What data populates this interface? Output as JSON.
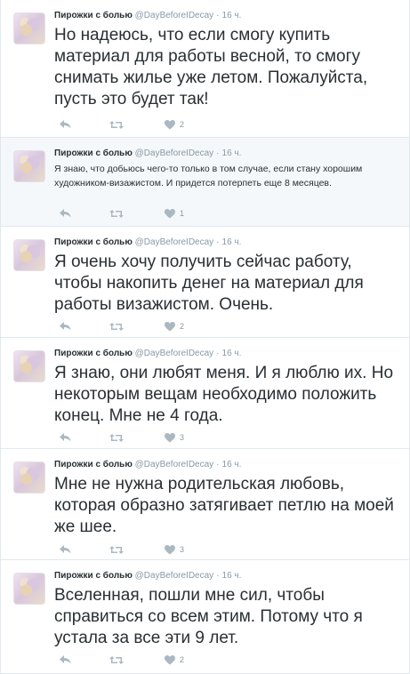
{
  "tweets": [
    {
      "name": "Пирожки с болью",
      "handle": "@DayBeforeIDecay",
      "time": "16 ч.",
      "text": "Но надеюсь, что если смогу купить материал для работы весной, то смогу снимать жилье уже летом. Пожалуйста, пусть это будет так!",
      "likes": "2"
    },
    {
      "name": "Пирожки с болью",
      "handle": "@DayBeforeIDecay",
      "time": "16 ч.",
      "text": "Я знаю, что добьюсь чего-то только в том случае, если стану хорошим художником-визажистом. И придется потерпеть еще 8 месяцев.",
      "likes": "1"
    },
    {
      "name": "Пирожки с болью",
      "handle": "@DayBeforeIDecay",
      "time": "16 ч.",
      "text": "Я очень хочу получить сейчас работу, чтобы накопить денег на материал для работы визажистом. Очень.",
      "likes": "2"
    },
    {
      "name": "Пирожки с болью",
      "handle": "@DayBeforeIDecay",
      "time": "16 ч.",
      "text": "Я знаю, они любят меня. И я люблю их. Но некоторым вещам необходимо положить конец. Мне не 4 года.",
      "likes": "3"
    },
    {
      "name": "Пирожки с болью",
      "handle": "@DayBeforeIDecay",
      "time": "16 ч.",
      "text": "Мне не нужна родительская любовь, которая образно затягивает петлю на моей же шее.",
      "likes": "3"
    },
    {
      "name": "Пирожки с болью",
      "handle": "@DayBeforeIDecay",
      "time": "16 ч.",
      "text": "Вселенная, пошли мне сил, чтобы справиться со всем этим. Потому что я устала за все эти 9 лет.",
      "likes": "2"
    }
  ],
  "colors": {
    "icon": "#aab8c2",
    "meta": "#8899a6",
    "text": "#292f33",
    "compact_bg": "#f5f8fa",
    "divider": "#e1e8ed"
  }
}
